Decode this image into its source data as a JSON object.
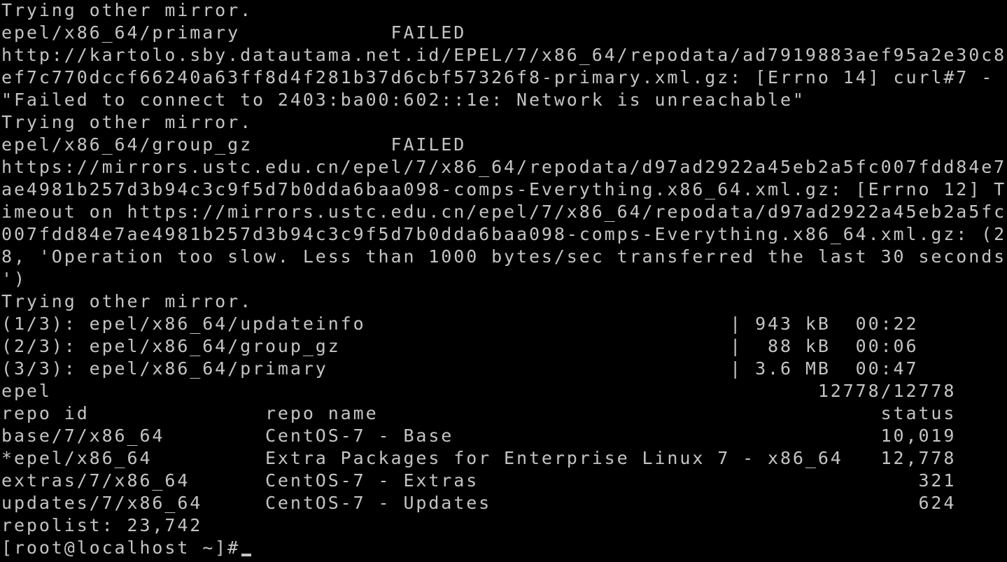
{
  "colors": {
    "background": "#000000",
    "foreground": "#c4c4c4"
  },
  "terminal": {
    "lines": [
      "Trying other mirror.",
      "epel/x86_64/primary            FAILED",
      "http://kartolo.sby.datautama.net.id/EPEL/7/x86_64/repodata/ad7919883aef95a2e30c8",
      "ef7c770dccf66240a63ff8d4f281b37d6cbf57326f8-primary.xml.gz: [Errno 14] curl#7 -",
      "\"Failed to connect to 2403:ba00:602::1e: Network is unreachable\"",
      "Trying other mirror.",
      "epel/x86_64/group_gz           FAILED",
      "https://mirrors.ustc.edu.cn/epel/7/x86_64/repodata/d97ad2922a45eb2a5fc007fdd84e7",
      "ae4981b257d3b94c3c9f5d7b0dda6baa098-comps-Everything.x86_64.xml.gz: [Errno 12] T",
      "imeout on https://mirrors.ustc.edu.cn/epel/7/x86_64/repodata/d97ad2922a45eb2a5fc",
      "007fdd84e7ae4981b257d3b94c3c9f5d7b0dda6baa098-comps-Everything.x86_64.xml.gz: (2",
      "8, 'Operation too slow. Less than 1000 bytes/sec transferred the last 30 seconds",
      "')",
      "Trying other mirror.",
      "(1/3): epel/x86_64/updateinfo                             | 943 kB  00:22",
      "(2/3): epel/x86_64/group_gz                               |  88 kB  00:06",
      "(3/3): epel/x86_64/primary                                | 3.6 MB  00:47",
      "epel                                                             12778/12778",
      "repo id              repo name                                        status",
      "base/7/x86_64        CentOS-7 - Base                                  10,019",
      "*epel/x86_64         Extra Packages for Enterprise Linux 7 - x86_64   12,778",
      "extras/7/x86_64      CentOS-7 - Extras                                   321",
      "updates/7/x86_64     CentOS-7 - Updates                                  624",
      "repolist: 23,742",
      "[root@localhost ~]#"
    ]
  }
}
